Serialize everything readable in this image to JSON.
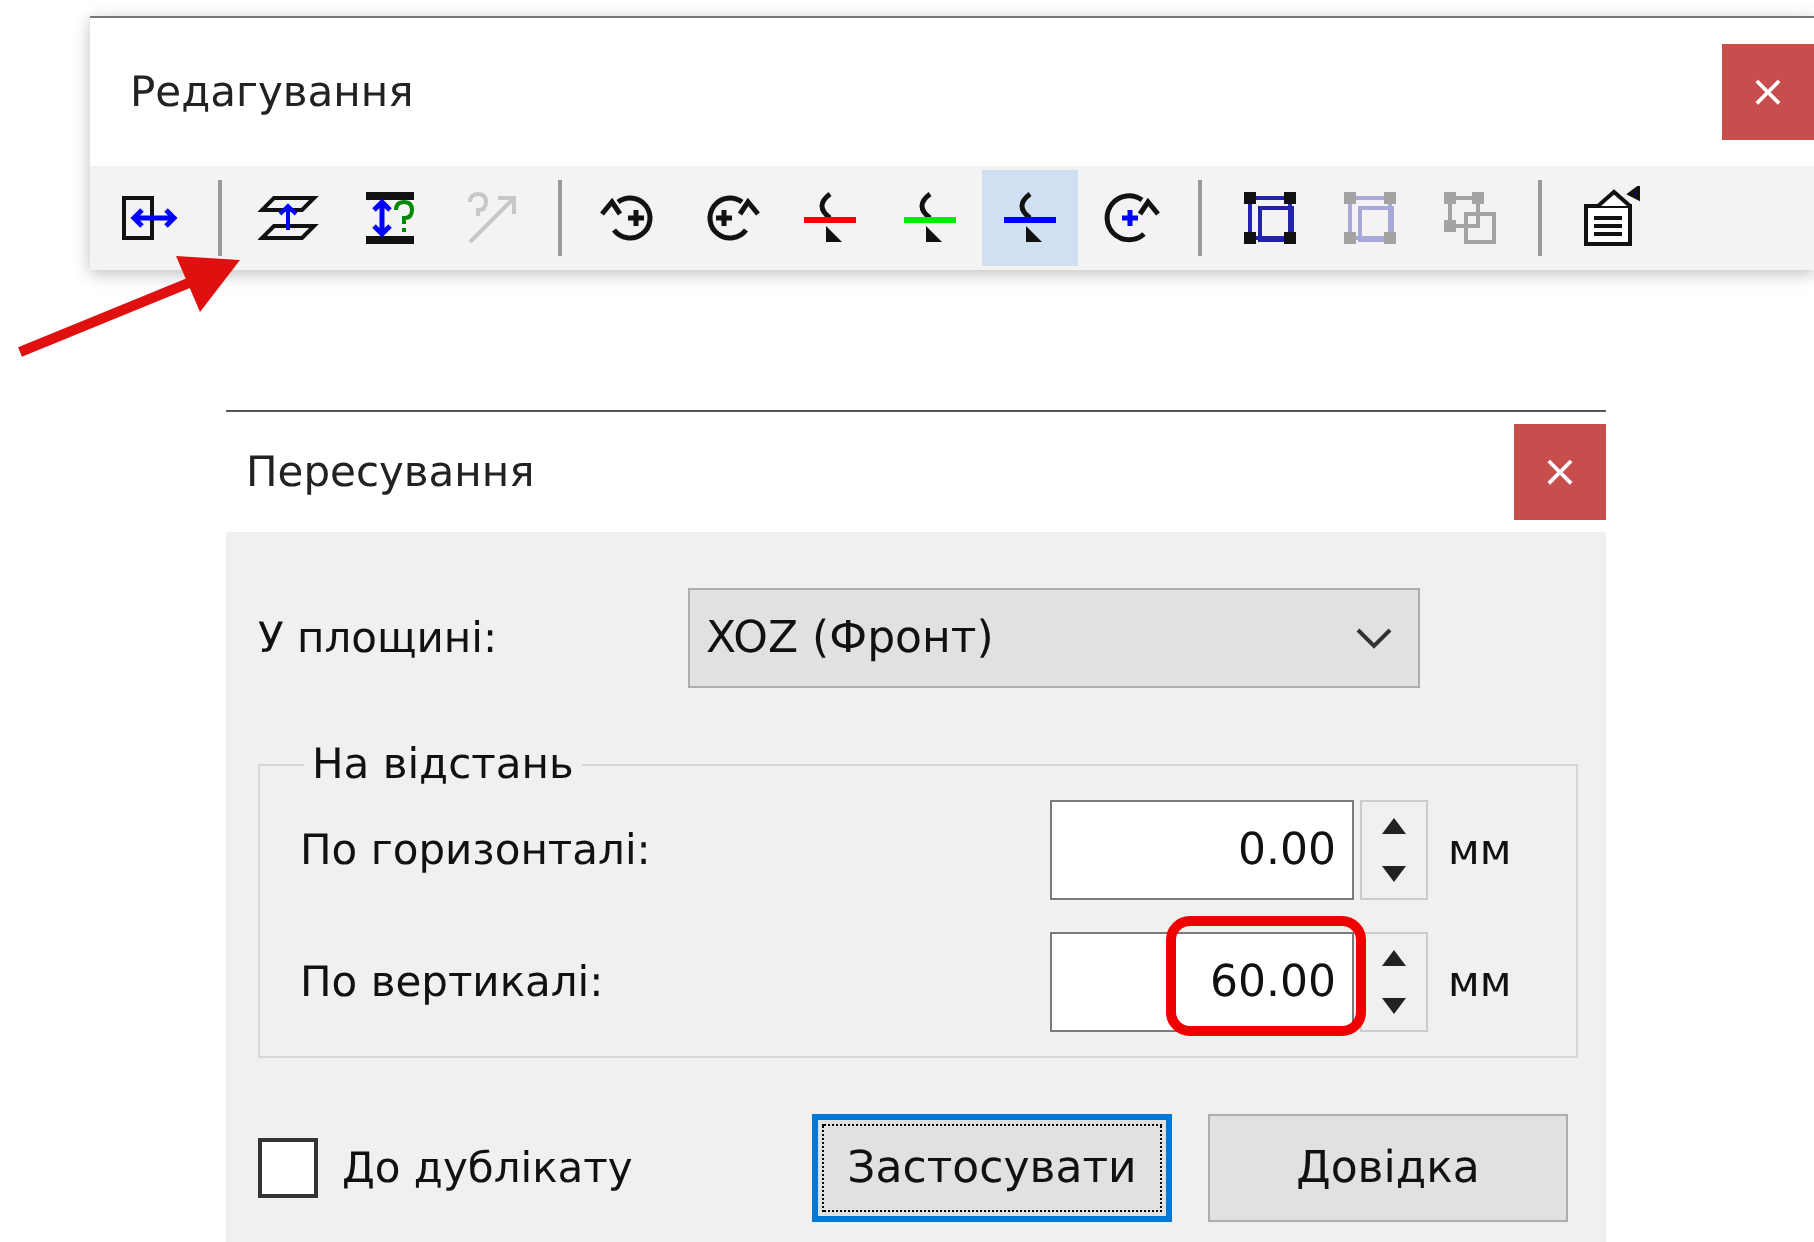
{
  "toolbar_window": {
    "title": "Редагування",
    "close": "×",
    "groups": [
      [
        {
          "kind": "frame-move",
          "disabled": false,
          "selected": false
        }
      ],
      [
        {
          "kind": "plane-move",
          "disabled": false,
          "selected": false
        },
        {
          "kind": "distance-query",
          "disabled": false,
          "selected": false
        },
        {
          "kind": "arrow-query",
          "disabled": true,
          "selected": false
        }
      ],
      [
        {
          "kind": "rotate-left",
          "disabled": false,
          "selected": false
        },
        {
          "kind": "rotate-right",
          "disabled": false,
          "selected": false
        },
        {
          "kind": "rotate-axis",
          "color": "#ff0000",
          "disabled": false,
          "selected": false
        },
        {
          "kind": "rotate-axis",
          "color": "#00ee00",
          "disabled": false,
          "selected": false
        },
        {
          "kind": "rotate-axis",
          "color": "#0000ff",
          "disabled": false,
          "selected": true
        },
        {
          "kind": "rotate-point",
          "disabled": false,
          "selected": false
        }
      ],
      [
        {
          "kind": "bounding-box",
          "disabled": false,
          "selected": false
        },
        {
          "kind": "bounding-box",
          "disabled": true,
          "selected": false
        },
        {
          "kind": "box-copy",
          "disabled": true,
          "selected": false
        }
      ],
      [
        {
          "kind": "properties",
          "disabled": false,
          "selected": false
        }
      ]
    ]
  },
  "annotations": {
    "arrow": true
  },
  "dialog": {
    "title": "Пересування",
    "close": "×",
    "plane": {
      "label": "У площині:",
      "value": "XOZ (Фронт)"
    },
    "group": {
      "legend": "На відстань",
      "fields": [
        {
          "label": "По горизонталі:",
          "value": "0.00",
          "unit": "мм",
          "highlighted": false
        },
        {
          "label": "По вертикалі:",
          "value": "60.00",
          "unit": "мм",
          "highlighted": true
        }
      ]
    },
    "duplicate": {
      "label": "До дублікату",
      "checked": false
    },
    "buttons": [
      {
        "label": "Застосувати",
        "default": true
      },
      {
        "label": "Довідка",
        "default": false
      }
    ]
  }
}
